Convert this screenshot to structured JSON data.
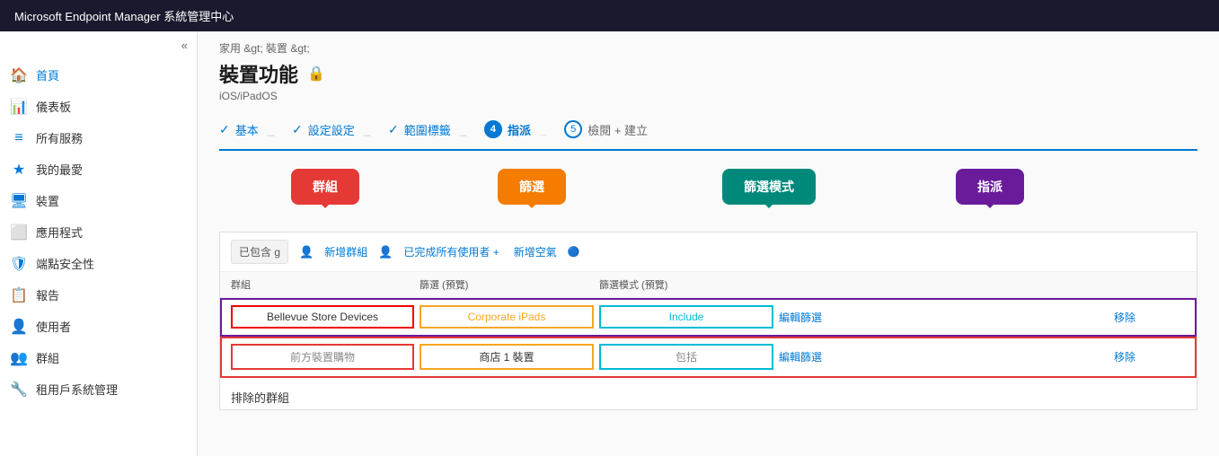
{
  "topbar": {
    "title": "Microsoft Endpoint Manager 系統管理中心"
  },
  "sidebar": {
    "collapse_icon": "«",
    "items": [
      {
        "label": "首頁",
        "icon": "🏠",
        "active": false
      },
      {
        "label": "儀表板",
        "icon": "📊",
        "active": false
      },
      {
        "label": "所有服務",
        "icon": "≡",
        "active": false
      },
      {
        "label": "我的最愛",
        "icon": "★",
        "active": false
      },
      {
        "label": "裝置",
        "icon": "🖥",
        "active": false
      },
      {
        "label": "應用程式",
        "icon": "⬜",
        "active": false
      },
      {
        "label": "端點安全性",
        "icon": "🛡",
        "active": false
      },
      {
        "label": "報告",
        "icon": "📋",
        "active": false
      },
      {
        "label": "使用者",
        "icon": "👤",
        "active": false
      },
      {
        "label": "群組",
        "icon": "👥",
        "active": false
      },
      {
        "label": "租用戶系統管理",
        "icon": "🔧",
        "active": false
      }
    ]
  },
  "breadcrumb": "家用 &gt; 裝置 &gt;",
  "page": {
    "title": "裝置功能",
    "lock_icon": "🔒",
    "subtitle": "iOS/iPadOS"
  },
  "steps": [
    {
      "label": "基本",
      "status": "completed"
    },
    {
      "label": "設定設定",
      "status": "completed"
    },
    {
      "label": "範圍標籤",
      "status": "completed"
    },
    {
      "label": "指派",
      "num": "4",
      "status": "active"
    },
    {
      "label": "檢閱 + 建立",
      "num": "5",
      "status": "inactive"
    }
  ],
  "assign_section": {
    "included_label": "已包含 g",
    "add_group_label": "新增群組",
    "add_all_users_label": "已完成所有使用者 +",
    "add_all_devices_label": "新增空氣",
    "col_headers": {
      "group": "群組",
      "filter": "篩選 (預覽)",
      "filter_mode": "篩選模式 (預覽)",
      "edit_filter": "",
      "remove": ""
    },
    "rows": [
      {
        "group": "Bellevue Store Devices",
        "filter": "Corporate iPads",
        "filter_mode": "Include",
        "edit_filter": "編輯篩選",
        "remove": "移除"
      },
      {
        "group": "前方裝置購物",
        "filter": "商店 1  裝置",
        "filter_mode": "包括",
        "edit_filter": "編輯篩選",
        "remove": "移除"
      }
    ],
    "excluded_title": "排除的群組"
  },
  "bubbles": [
    {
      "label": "群組",
      "color": "red"
    },
    {
      "label": "篩選",
      "color": "orange"
    },
    {
      "label": "篩選模式",
      "color": "teal"
    },
    {
      "label": "指派",
      "color": "purple"
    }
  ]
}
